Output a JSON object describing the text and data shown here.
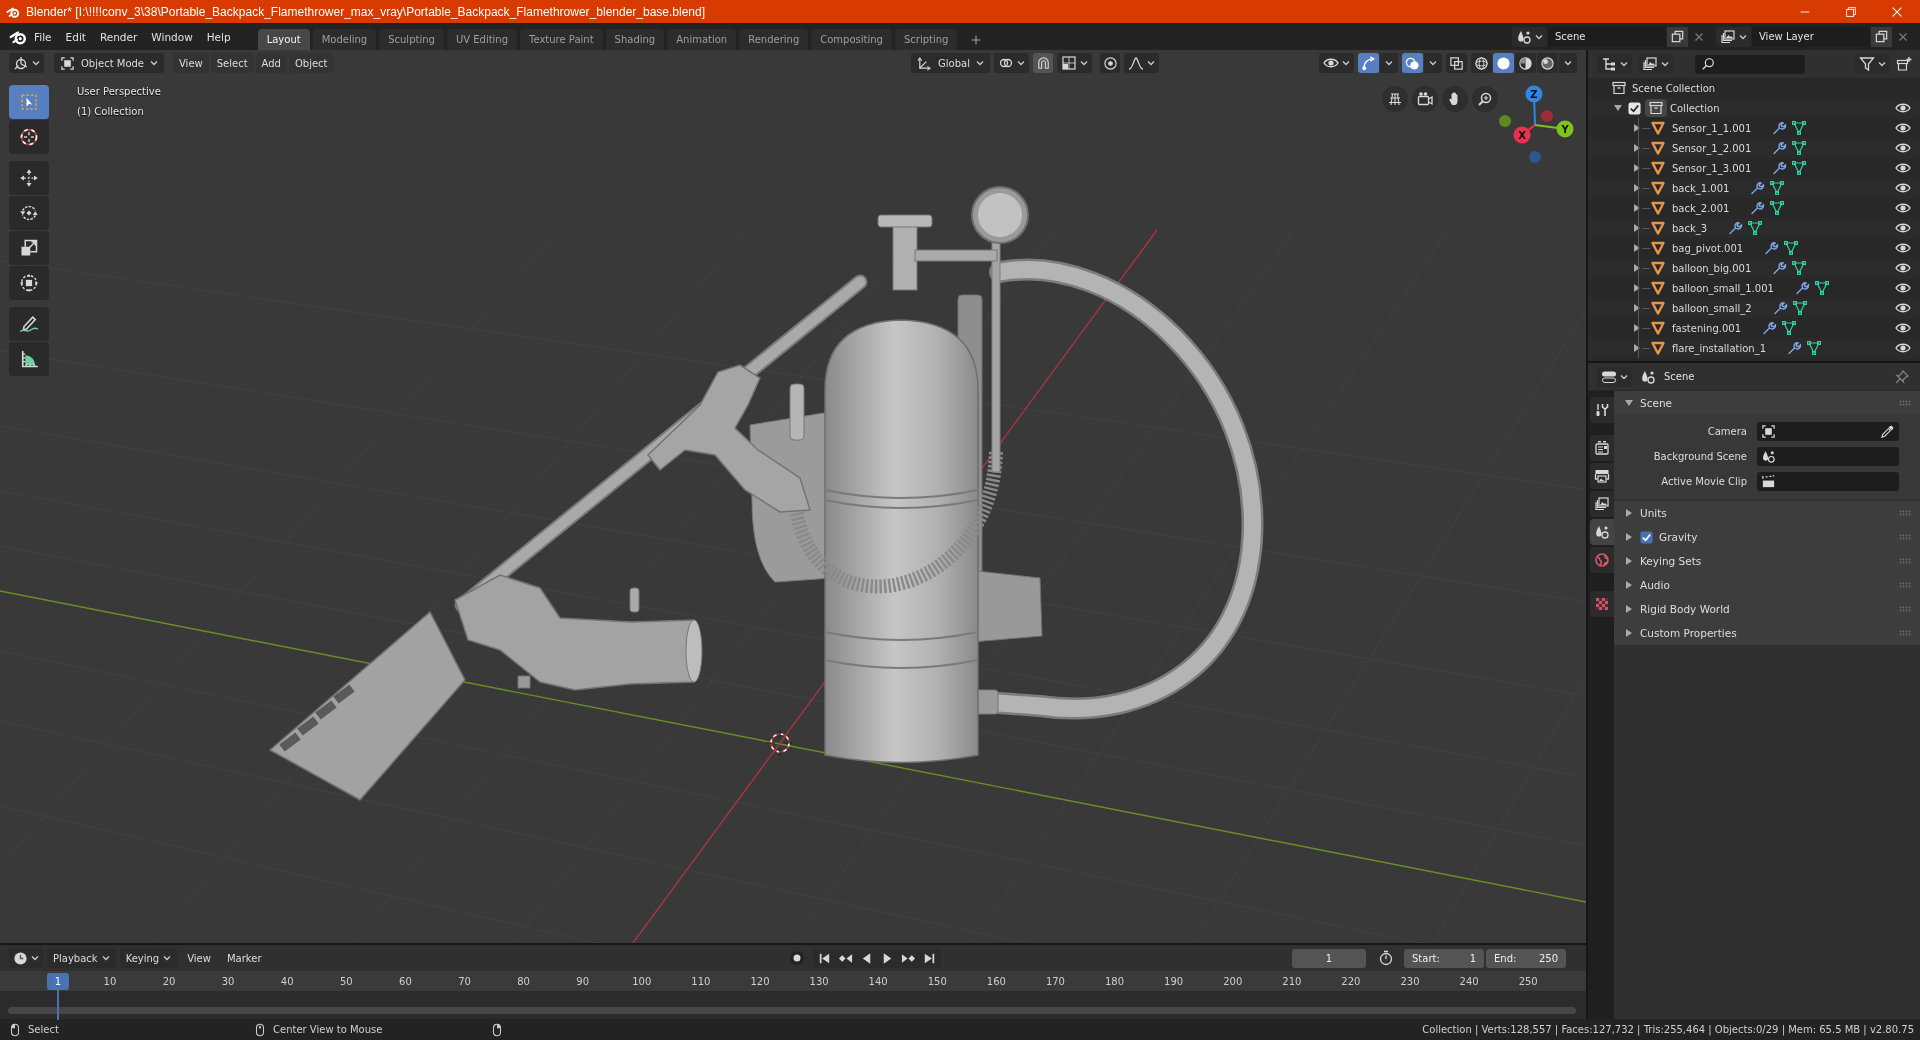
{
  "window": {
    "title": "Blender* [I:\\!!!!conv_3\\38\\Portable_Backpack_Flamethrower_max_vray\\Portable_Backpack_Flamethrower_blender_base.blend]"
  },
  "menu": [
    "File",
    "Edit",
    "Render",
    "Window",
    "Help"
  ],
  "workspaces": [
    {
      "label": "Layout",
      "selected": true
    },
    {
      "label": "Modeling",
      "selected": false
    },
    {
      "label": "Sculpting",
      "selected": false
    },
    {
      "label": "UV Editing",
      "selected": false
    },
    {
      "label": "Texture Paint",
      "selected": false
    },
    {
      "label": "Shading",
      "selected": false
    },
    {
      "label": "Animation",
      "selected": false
    },
    {
      "label": "Rendering",
      "selected": false
    },
    {
      "label": "Compositing",
      "selected": false
    },
    {
      "label": "Scripting",
      "selected": false
    }
  ],
  "scene": {
    "value": "Scene"
  },
  "view_layer": {
    "value": "View Layer"
  },
  "viewport": {
    "mode": "Object Mode",
    "menus": [
      "View",
      "Select",
      "Add",
      "Object"
    ],
    "orientation": "Global",
    "gizmos_on": true,
    "overlays_on": true,
    "xray_on": false,
    "shading": [
      {
        "selected": false
      },
      {
        "selected": true
      },
      {
        "selected": false
      },
      {
        "selected": false
      }
    ],
    "tools": [
      {
        "selected": true
      },
      {
        "selected": false
      },
      {
        "selected": false
      },
      {
        "selected": false
      },
      {
        "selected": false
      },
      {
        "selected": false
      },
      {
        "selected": false
      },
      {
        "selected": false
      }
    ],
    "info": [
      "User Perspective",
      "(1) Collection"
    ],
    "axis_labels": {
      "x": "X",
      "y": "Y",
      "z": "Z"
    }
  },
  "outliner": {
    "root": {
      "name": "Scene Collection",
      "children": [
        {
          "name": "Collection",
          "checked": true,
          "expanded": true,
          "visible": true,
          "children": [
            {
              "name": "Sensor_1_1.001",
              "expanded": false,
              "visible": true
            },
            {
              "name": "Sensor_1_2.001",
              "expanded": false,
              "visible": true
            },
            {
              "name": "Sensor_1_3.001",
              "expanded": false,
              "visible": true
            },
            {
              "name": "back_1.001",
              "expanded": false,
              "visible": true
            },
            {
              "name": "back_2.001",
              "expanded": false,
              "visible": true
            },
            {
              "name": "back_3",
              "expanded": false,
              "visible": true
            },
            {
              "name": "bag_pivot.001",
              "expanded": false,
              "visible": true
            },
            {
              "name": "balloon_big.001",
              "expanded": false,
              "visible": true
            },
            {
              "name": "balloon_small_1.001",
              "expanded": false,
              "visible": true
            },
            {
              "name": "balloon_small_2",
              "expanded": false,
              "visible": true
            },
            {
              "name": "fastening.001",
              "expanded": false,
              "visible": true
            },
            {
              "name": "flare_installation_1",
              "expanded": false,
              "visible": true
            }
          ]
        }
      ]
    }
  },
  "properties": {
    "context": "Scene",
    "tabs": [
      {
        "selected": false
      },
      {
        "selected": false
      },
      {
        "selected": false
      },
      {
        "selected": false
      },
      {
        "selected": true
      },
      {
        "selected": false
      },
      {
        "selected": false
      }
    ],
    "panels": [
      {
        "kind": "fields",
        "title": "Scene",
        "expanded": true,
        "fields": [
          {
            "label": "Camera"
          },
          {
            "label": "Background Scene"
          },
          {
            "label": "Active Movie Clip"
          }
        ]
      },
      {
        "kind": "plain",
        "title": "Units",
        "expanded": false
      },
      {
        "kind": "checkbox",
        "title": "Gravity",
        "expanded": false,
        "checked": true
      },
      {
        "kind": "plain",
        "title": "Keying Sets",
        "expanded": false
      },
      {
        "kind": "plain",
        "title": "Audio",
        "expanded": false
      },
      {
        "kind": "plain",
        "title": "Rigid Body World",
        "expanded": false
      },
      {
        "kind": "plain",
        "title": "Custom Properties",
        "expanded": false
      }
    ]
  },
  "timeline": {
    "menus": [
      {
        "label": "Playback",
        "dropdown": true
      },
      {
        "label": "Keying",
        "dropdown": true
      },
      {
        "label": "View",
        "dropdown": false
      },
      {
        "label": "Marker",
        "dropdown": false
      }
    ],
    "current_frame": "1",
    "start_label": "Start:",
    "start": "1",
    "end_label": "End:",
    "end": "250",
    "playhead": "1",
    "ruler": [
      "10",
      "20",
      "30",
      "40",
      "50",
      "60",
      "70",
      "80",
      "90",
      "100",
      "110",
      "120",
      "130",
      "140",
      "150",
      "160",
      "170",
      "180",
      "190",
      "200",
      "210",
      "220",
      "230",
      "240",
      "250"
    ]
  },
  "status_bar": {
    "hints": [
      "Select",
      "Center View to Mouse"
    ],
    "stats": "Collection | Verts:128,557 | Faces:127,732 | Tris:255,464 | Objects:0/29 | Mem: 65.5 MB | v2.80.75"
  }
}
